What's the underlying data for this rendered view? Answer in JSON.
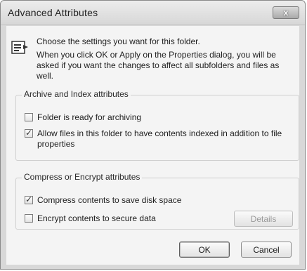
{
  "window": {
    "title": "Advanced Attributes",
    "close_label": "x"
  },
  "info": {
    "line1": "Choose the settings you want for this folder.",
    "line2": "When you click OK or Apply on the Properties dialog, you will be asked if you want the changes to affect all subfolders and files as well."
  },
  "archive_group": {
    "title": "Archive and Index attributes",
    "items": [
      {
        "label": "Folder is ready for archiving",
        "checked": false
      },
      {
        "label": "Allow files in this folder to have contents indexed in addition to file properties",
        "checked": true
      }
    ]
  },
  "compress_group": {
    "title": "Compress or Encrypt attributes",
    "items": [
      {
        "label": "Compress contents to save disk space",
        "checked": true
      },
      {
        "label": "Encrypt contents to secure data",
        "checked": false
      }
    ],
    "details_label": "Details"
  },
  "buttons": {
    "ok": "OK",
    "cancel": "Cancel"
  }
}
